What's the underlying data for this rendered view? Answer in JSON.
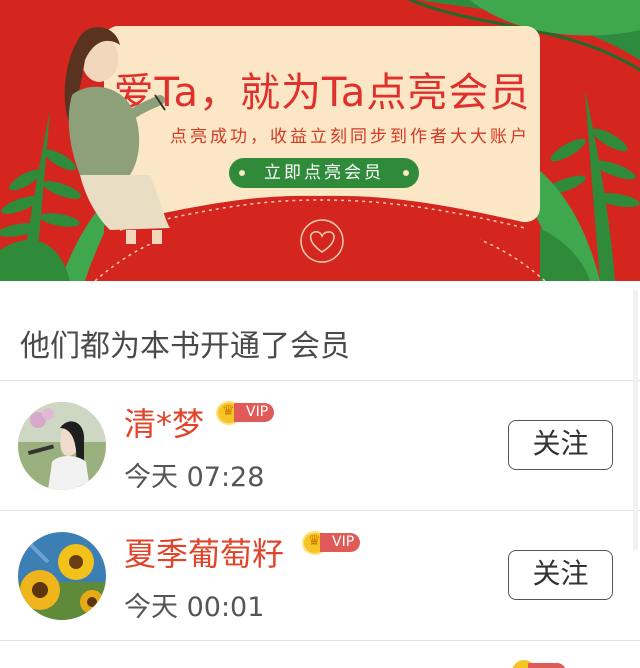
{
  "banner": {
    "title": "爱Ta，就为Ta点亮会员",
    "subtitle": "点亮成功，收益立刻同步到作者大大账户",
    "cta_label": "立即点亮会员"
  },
  "section": {
    "title": "他们都为本书开通了会员"
  },
  "members": [
    {
      "name": "清*梦",
      "vip_label": "VIP",
      "time": "今天 07:28",
      "follow_label": "关注"
    },
    {
      "name": "夏季葡萄籽",
      "vip_label": "VIP",
      "time": "今天 00:01",
      "follow_label": "关注"
    }
  ],
  "colors": {
    "banner_red": "#d5251f",
    "card_cream": "#fbe6c6",
    "cta_green": "#2f8a3a",
    "name_orange": "#e2442a"
  }
}
